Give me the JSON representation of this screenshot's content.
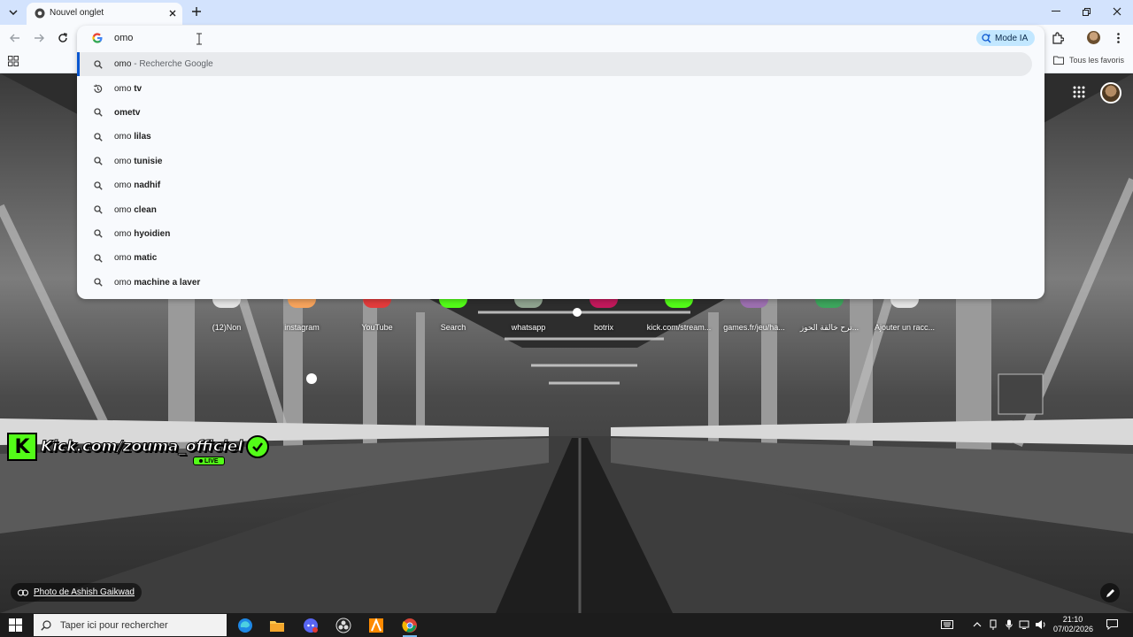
{
  "browser": {
    "tab_title": "Nouvel onglet",
    "omnibox_query": "omo",
    "mode_ia_label": "Mode IA",
    "all_bookmarks_label": "Tous les favoris"
  },
  "suggestions": [
    {
      "prefix": "omo",
      "rest": "",
      "sub": " - Recherche Google",
      "icon": "search-icon",
      "selected": true
    },
    {
      "prefix": "omo",
      "rest": " tv",
      "sub": "",
      "icon": "history-icon"
    },
    {
      "prefix": "",
      "rest": "ometv",
      "sub": "",
      "icon": "search-icon"
    },
    {
      "prefix": "omo",
      "rest": " lilas",
      "sub": "",
      "icon": "search-icon"
    },
    {
      "prefix": "omo",
      "rest": " tunisie",
      "sub": "",
      "icon": "search-icon"
    },
    {
      "prefix": "omo",
      "rest": " nadhif",
      "sub": "",
      "icon": "search-icon"
    },
    {
      "prefix": "omo",
      "rest": " clean",
      "sub": "",
      "icon": "search-icon"
    },
    {
      "prefix": "omo",
      "rest": " hyoidien",
      "sub": "",
      "icon": "search-icon"
    },
    {
      "prefix": "omo",
      "rest": " matic",
      "sub": "",
      "icon": "search-icon"
    },
    {
      "prefix": "omo",
      "rest": " machine a laver",
      "sub": "",
      "icon": "search-icon"
    }
  ],
  "shortcuts": [
    {
      "label": "(12)Non"
    },
    {
      "label": "instagram"
    },
    {
      "label": "YouTube"
    },
    {
      "label": "Search"
    },
    {
      "label": "whatsapp"
    },
    {
      "label": "botrix"
    },
    {
      "label": "kick.com/stream..."
    },
    {
      "label": "games.fr/jeu/ha..."
    },
    {
      "label": "ترح خالقة الحوز..."
    },
    {
      "label": "Ajouter un racc..."
    }
  ],
  "overlay": {
    "kick_text": "Kick.com/zouma_officiel",
    "live_label": "LIVE"
  },
  "photo_credit": "Photo de Ashish Gaikwad",
  "taskbar": {
    "search_placeholder": "Taper ici pour rechercher",
    "time": "21:10",
    "date": "07/02/2026"
  },
  "colors": {
    "tabstrip": "#d3e3fd",
    "toolbar": "#f8fafd",
    "mode_ia_bg": "#c2e7ff",
    "kick_green": "#53fc18",
    "taskbar": "#1c1c1c"
  }
}
